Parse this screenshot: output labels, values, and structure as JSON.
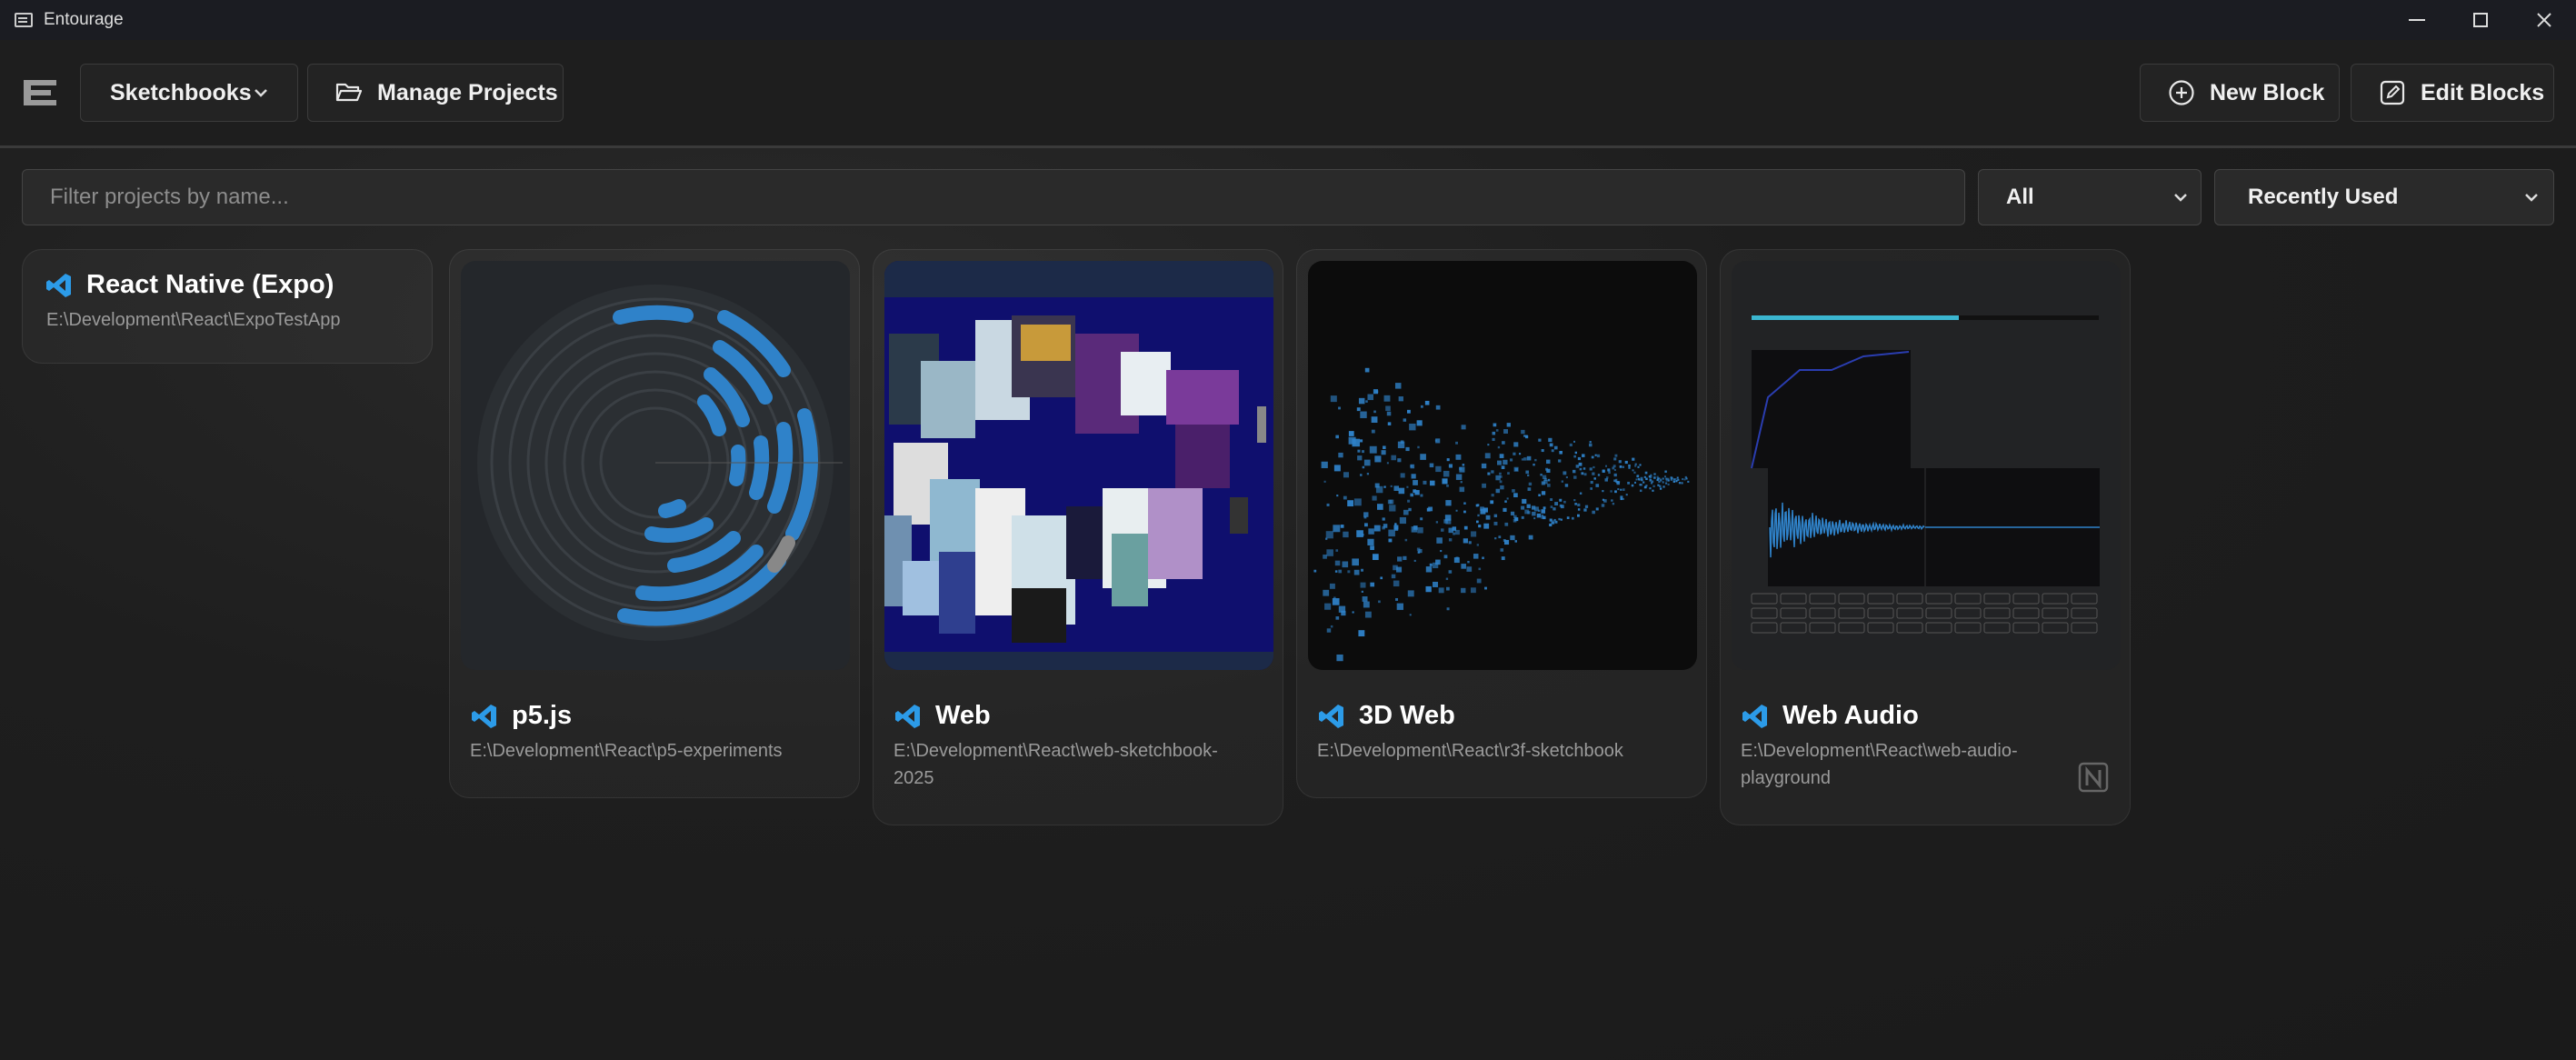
{
  "window": {
    "title": "Entourage"
  },
  "toolbar": {
    "category_label": "Sketchbooks",
    "manage_label": "Manage Projects",
    "new_block_label": "New Block",
    "edit_blocks_label": "Edit Blocks"
  },
  "filter": {
    "placeholder": "Filter projects by name...",
    "type_value": "All",
    "sort_value": "Recently Used"
  },
  "projects": [
    {
      "name": "React Native (Expo)",
      "path": "E:\\Development\\React\\ExpoTestApp",
      "icon": "vscode-icon"
    },
    {
      "name": "p5.js",
      "path": "E:\\Development\\React\\p5-experiments",
      "icon": "vscode-icon"
    },
    {
      "name": "Web",
      "path": "E:\\Development\\React\\web-sketchbook-2025",
      "icon": "vscode-icon"
    },
    {
      "name": "3D Web",
      "path": "E:\\Development\\React\\r3f-sketchbook",
      "icon": "vscode-icon"
    },
    {
      "name": "Web Audio",
      "path": "E:\\Development\\React\\web-audio-playground",
      "icon": "vscode-icon",
      "extra_icon": "notion-icon"
    }
  ],
  "colors": {
    "accent": "#2f82c9",
    "vscode": "#2c9be8"
  }
}
